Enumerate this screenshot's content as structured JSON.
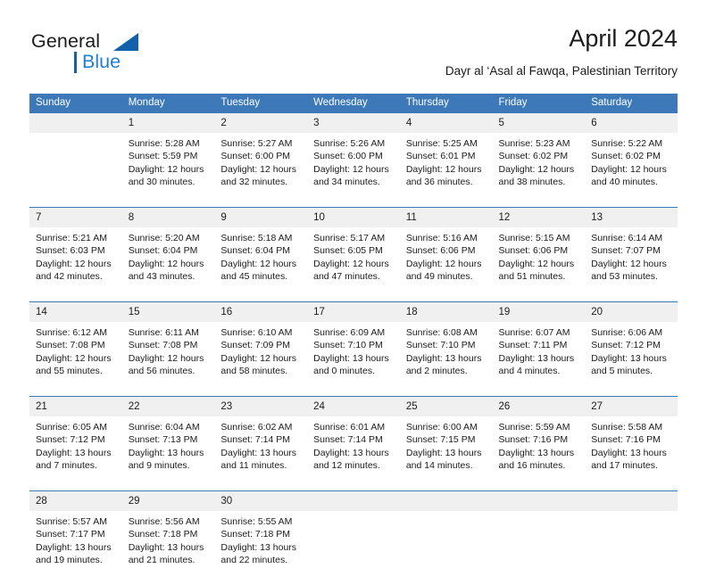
{
  "logo": {
    "primary_text": "General",
    "secondary_text": "Blue",
    "primary_color": "#1b1b1b",
    "secondary_color": "#1f7fd4",
    "accent_color": "#1461ab"
  },
  "header": {
    "title": "April 2024",
    "subtitle": "Dayr al ‘Asal al Fawqa, Palestinian Territory"
  },
  "theme": {
    "header_bg": "#3d79b8",
    "header_text": "#ffffff",
    "daynum_bg": "#f0f0f0",
    "cell_bg": "#ffffff",
    "text": "#1b1b1b"
  },
  "calendar": {
    "columns": [
      "Sunday",
      "Monday",
      "Tuesday",
      "Wednesday",
      "Thursday",
      "Friday",
      "Saturday"
    ],
    "weeks": [
      [
        {
          "day": "",
          "lines": []
        },
        {
          "day": "1",
          "lines": [
            "Sunrise: 5:28 AM",
            "Sunset: 5:59 PM",
            "Daylight: 12 hours and 30 minutes."
          ]
        },
        {
          "day": "2",
          "lines": [
            "Sunrise: 5:27 AM",
            "Sunset: 6:00 PM",
            "Daylight: 12 hours and 32 minutes."
          ]
        },
        {
          "day": "3",
          "lines": [
            "Sunrise: 5:26 AM",
            "Sunset: 6:00 PM",
            "Daylight: 12 hours and 34 minutes."
          ]
        },
        {
          "day": "4",
          "lines": [
            "Sunrise: 5:25 AM",
            "Sunset: 6:01 PM",
            "Daylight: 12 hours and 36 minutes."
          ]
        },
        {
          "day": "5",
          "lines": [
            "Sunrise: 5:23 AM",
            "Sunset: 6:02 PM",
            "Daylight: 12 hours and 38 minutes."
          ]
        },
        {
          "day": "6",
          "lines": [
            "Sunrise: 5:22 AM",
            "Sunset: 6:02 PM",
            "Daylight: 12 hours and 40 minutes."
          ]
        }
      ],
      [
        {
          "day": "7",
          "lines": [
            "Sunrise: 5:21 AM",
            "Sunset: 6:03 PM",
            "Daylight: 12 hours and 42 minutes."
          ]
        },
        {
          "day": "8",
          "lines": [
            "Sunrise: 5:20 AM",
            "Sunset: 6:04 PM",
            "Daylight: 12 hours and 43 minutes."
          ]
        },
        {
          "day": "9",
          "lines": [
            "Sunrise: 5:18 AM",
            "Sunset: 6:04 PM",
            "Daylight: 12 hours and 45 minutes."
          ]
        },
        {
          "day": "10",
          "lines": [
            "Sunrise: 5:17 AM",
            "Sunset: 6:05 PM",
            "Daylight: 12 hours and 47 minutes."
          ]
        },
        {
          "day": "11",
          "lines": [
            "Sunrise: 5:16 AM",
            "Sunset: 6:06 PM",
            "Daylight: 12 hours and 49 minutes."
          ]
        },
        {
          "day": "12",
          "lines": [
            "Sunrise: 5:15 AM",
            "Sunset: 6:06 PM",
            "Daylight: 12 hours and 51 minutes."
          ]
        },
        {
          "day": "13",
          "lines": [
            "Sunrise: 6:14 AM",
            "Sunset: 7:07 PM",
            "Daylight: 12 hours and 53 minutes."
          ]
        }
      ],
      [
        {
          "day": "14",
          "lines": [
            "Sunrise: 6:12 AM",
            "Sunset: 7:08 PM",
            "Daylight: 12 hours and 55 minutes."
          ]
        },
        {
          "day": "15",
          "lines": [
            "Sunrise: 6:11 AM",
            "Sunset: 7:08 PM",
            "Daylight: 12 hours and 56 minutes."
          ]
        },
        {
          "day": "16",
          "lines": [
            "Sunrise: 6:10 AM",
            "Sunset: 7:09 PM",
            "Daylight: 12 hours and 58 minutes."
          ]
        },
        {
          "day": "17",
          "lines": [
            "Sunrise: 6:09 AM",
            "Sunset: 7:10 PM",
            "Daylight: 13 hours and 0 minutes."
          ]
        },
        {
          "day": "18",
          "lines": [
            "Sunrise: 6:08 AM",
            "Sunset: 7:10 PM",
            "Daylight: 13 hours and 2 minutes."
          ]
        },
        {
          "day": "19",
          "lines": [
            "Sunrise: 6:07 AM",
            "Sunset: 7:11 PM",
            "Daylight: 13 hours and 4 minutes."
          ]
        },
        {
          "day": "20",
          "lines": [
            "Sunrise: 6:06 AM",
            "Sunset: 7:12 PM",
            "Daylight: 13 hours and 5 minutes."
          ]
        }
      ],
      [
        {
          "day": "21",
          "lines": [
            "Sunrise: 6:05 AM",
            "Sunset: 7:12 PM",
            "Daylight: 13 hours and 7 minutes."
          ]
        },
        {
          "day": "22",
          "lines": [
            "Sunrise: 6:04 AM",
            "Sunset: 7:13 PM",
            "Daylight: 13 hours and 9 minutes."
          ]
        },
        {
          "day": "23",
          "lines": [
            "Sunrise: 6:02 AM",
            "Sunset: 7:14 PM",
            "Daylight: 13 hours and 11 minutes."
          ]
        },
        {
          "day": "24",
          "lines": [
            "Sunrise: 6:01 AM",
            "Sunset: 7:14 PM",
            "Daylight: 13 hours and 12 minutes."
          ]
        },
        {
          "day": "25",
          "lines": [
            "Sunrise: 6:00 AM",
            "Sunset: 7:15 PM",
            "Daylight: 13 hours and 14 minutes."
          ]
        },
        {
          "day": "26",
          "lines": [
            "Sunrise: 5:59 AM",
            "Sunset: 7:16 PM",
            "Daylight: 13 hours and 16 minutes."
          ]
        },
        {
          "day": "27",
          "lines": [
            "Sunrise: 5:58 AM",
            "Sunset: 7:16 PM",
            "Daylight: 13 hours and 17 minutes."
          ]
        }
      ],
      [
        {
          "day": "28",
          "lines": [
            "Sunrise: 5:57 AM",
            "Sunset: 7:17 PM",
            "Daylight: 13 hours and 19 minutes."
          ]
        },
        {
          "day": "29",
          "lines": [
            "Sunrise: 5:56 AM",
            "Sunset: 7:18 PM",
            "Daylight: 13 hours and 21 minutes."
          ]
        },
        {
          "day": "30",
          "lines": [
            "Sunrise: 5:55 AM",
            "Sunset: 7:18 PM",
            "Daylight: 13 hours and 22 minutes."
          ]
        },
        {
          "day": "",
          "lines": []
        },
        {
          "day": "",
          "lines": []
        },
        {
          "day": "",
          "lines": []
        },
        {
          "day": "",
          "lines": []
        }
      ]
    ]
  }
}
